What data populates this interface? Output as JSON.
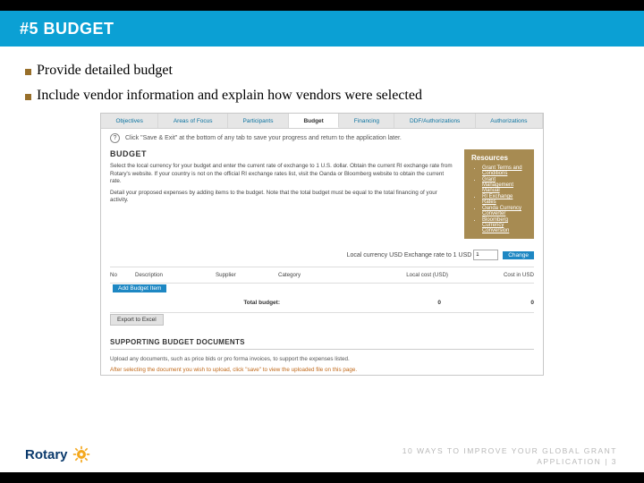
{
  "slide": {
    "title": "#5 BUDGET",
    "bullets": [
      "Provide detailed budget",
      "Include vendor information and explain how vendors were selected"
    ]
  },
  "screenshot": {
    "tabs": [
      "Objectives",
      "Areas of Focus",
      "Participants",
      "Budget",
      "Financing",
      "DDF/Authorizations",
      "Authorizations"
    ],
    "active_tab": "Budget",
    "save_hint": "Click \"Save & Exit\" at the bottom of any tab to save your progress and return to the application later.",
    "heading": "BUDGET",
    "para1": "Select the local currency for your budget and enter the current rate of exchange to 1 U.S. dollar. Obtain the current RI exchange rate from Rotary's website. If your country is not on the official RI exchange rates list, visit the Oanda or Bloomberg website to obtain the current rate.",
    "para2": "Detail your proposed expenses by adding items to the budget. Note that the total budget must be equal to the total financing of your activity.",
    "resources_label": "Resources",
    "resources": [
      "Grant Terms and Conditions",
      "Grant Management Manual",
      "RI Exchange Rates",
      "Oanda Currency Converter",
      "Bloomberg Currency Conversion"
    ],
    "rate_label": "Local currency USD Exchange rate to 1 USD",
    "rate_value": "1",
    "change_label": "Change",
    "columns": {
      "no": "No",
      "desc": "Description",
      "supplier": "Supplier",
      "category": "Category",
      "local": "Local cost (USD)",
      "usd": "Cost in USD"
    },
    "add_item_label": "Add Budget Item",
    "total_label": "Total budget:",
    "total_local": "0",
    "total_usd": "0",
    "export_label": "Export to Excel",
    "supporting_heading": "SUPPORTING BUDGET DOCUMENTS",
    "upload_note": "Upload any documents, such as price bids or pro forma invoices, to support the expenses listed.",
    "after_upload_note": "After selecting the document you wish to upload, click \"save\" to view the uploaded file on this page."
  },
  "footer": {
    "line1": "10 WAYS TO IMPROVE YOUR GLOBAL GRANT",
    "line2": "APPLICATION",
    "page": "3",
    "logo_text": "Rotary"
  }
}
